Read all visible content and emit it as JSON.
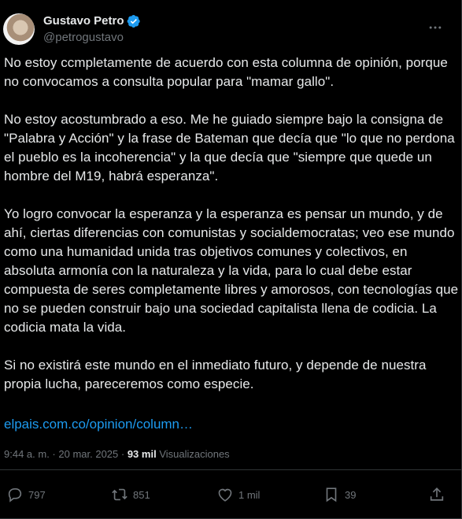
{
  "author": {
    "name": "Gustavo Petro",
    "handle": "@petrogustavo",
    "verified_icon": "verified-badge-icon",
    "badge_color": "#1d9bf0"
  },
  "tweet": {
    "paragraphs": [
      "No estoy ccmpletamente de acuerdo con esta columna de opinión, porque no convocamos a consulta popular para \"mamar gallo\".",
      "No estoy acostumbrado a eso. Me he guiado siempre bajo la consigna de \"Palabra y Acción\" y la frase de Bateman que decía que \"lo que no perdona el pueblo es la incoherencia\" y la que decía que \"siempre que quede un hombre del M19, habrá esperanza\".",
      "Yo logro convocar la esperanza y la esperanza es pensar un mundo, y de ahí, ciertas diferencias con comunistas y socialdemocratas; veo ese mundo como una humanidad unida tras objetivos comunes y colectivos, en absoluta armonía con la naturaleza y la vida, para lo cual debe estar compuesta de seres completamente libres y amorosos, con tecnologías que no se pueden construir bajo una sociedad capitalista llena de codicia. La codicia mata la vida.",
      "Si no existirá este mundo en el inmediato futuro, y depende de nuestra propia lucha, pareceremos como especie."
    ],
    "link": "elpais.com.co/opinion/column…",
    "link_color": "#1d9bf0"
  },
  "meta": {
    "time": "9:44 a. m.",
    "separator": " · ",
    "date": "20 mar. 2025",
    "views_count": "93 mil",
    "views_label": "Visualizaciones"
  },
  "actions": {
    "replies": "797",
    "reposts": "851",
    "likes": "1 mil",
    "bookmarks": "39"
  }
}
